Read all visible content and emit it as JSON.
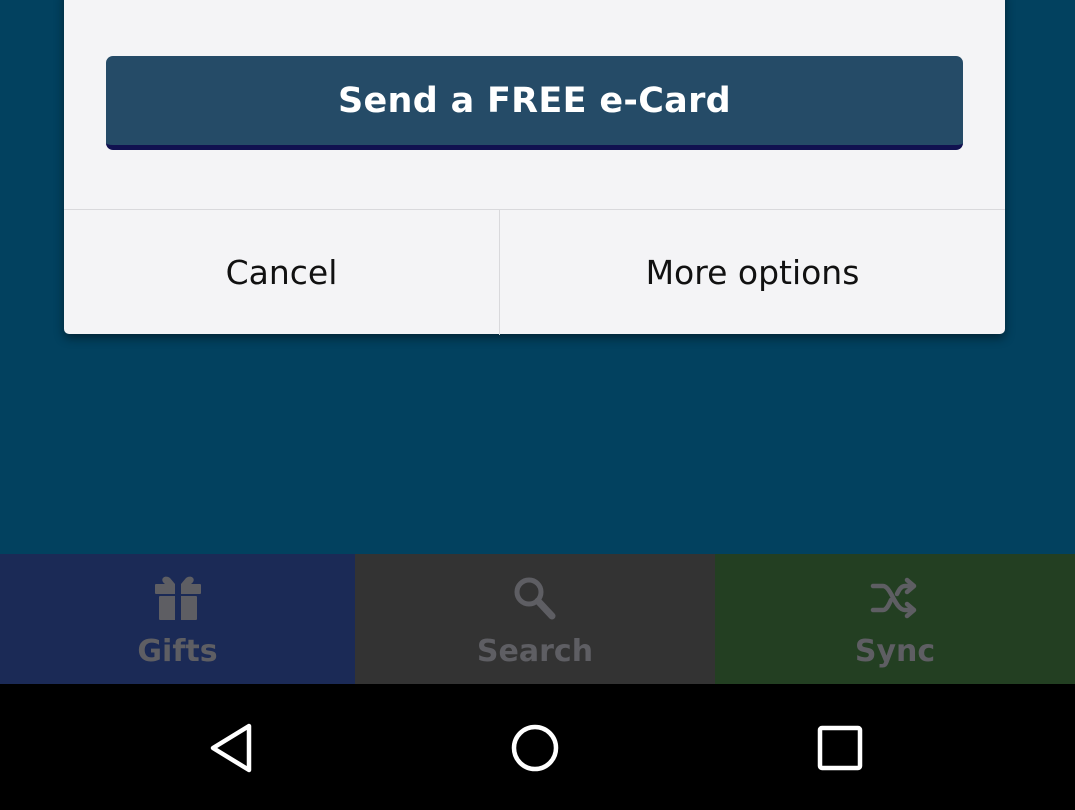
{
  "dialog": {
    "primary_button": "Send a FREE e-Card",
    "cancel_button": "Cancel",
    "more_options_button": "More options"
  },
  "tabs": [
    {
      "label": "Gifts",
      "icon": "gift-icon",
      "color": "#1b2a56"
    },
    {
      "label": "Search",
      "icon": "search-icon",
      "color": "#333333"
    },
    {
      "label": "Sync",
      "icon": "shuffle-icon",
      "color": "#233f22"
    }
  ],
  "navbar": {
    "buttons": [
      "back-icon",
      "home-icon",
      "recents-icon"
    ]
  },
  "colors": {
    "background": "#02415f",
    "dialog": "#f4f4f6",
    "primary_button": "#254b67",
    "tab_label": "#5e5e63"
  }
}
